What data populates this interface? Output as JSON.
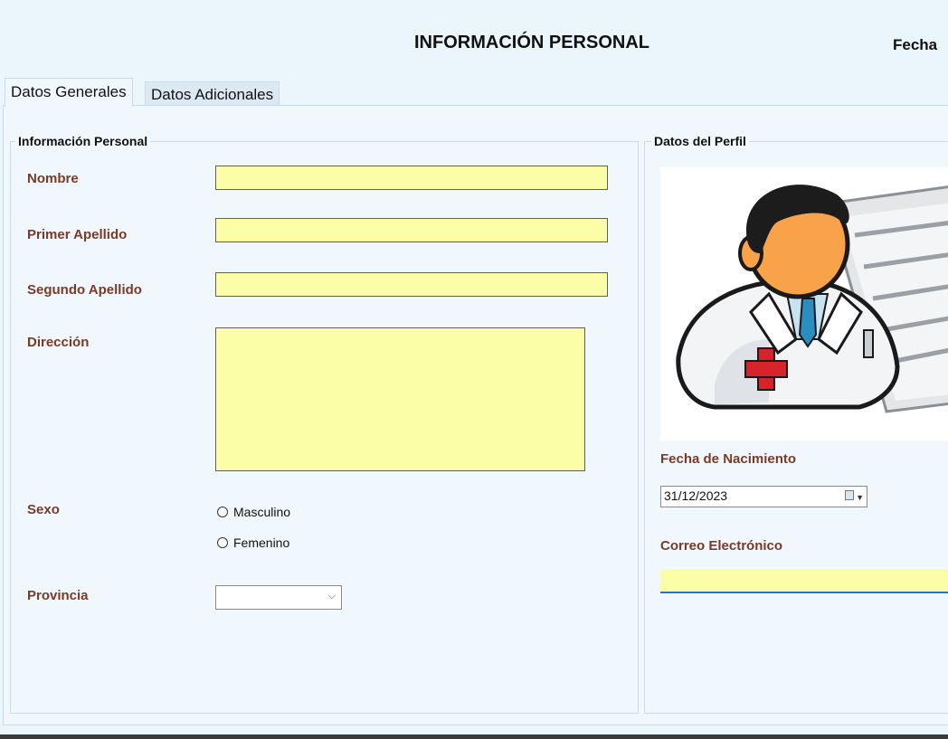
{
  "header": {
    "title": "INFORMACIÓN PERSONAL",
    "fecha_label": "Fecha"
  },
  "tabs": [
    {
      "label": "Datos Generales",
      "active": true
    },
    {
      "label": "Datos Adicionales",
      "active": false
    }
  ],
  "personal": {
    "group_title": "Información Personal",
    "nombre_label": "Nombre",
    "nombre_value": "",
    "primer_apellido_label": "Primer Apellido",
    "primer_apellido_value": "",
    "segundo_apellido_label": "Segundo Apellido",
    "segundo_apellido_value": "",
    "direccion_label": "Dirección",
    "direccion_value": "",
    "sexo_label": "Sexo",
    "sexo_options": [
      "Masculino",
      "Femenino"
    ],
    "provincia_label": "Provincia",
    "provincia_value": ""
  },
  "perfil": {
    "group_title": "Datos del Perfil",
    "avatar_icon": "doctor-avatar-icon",
    "fecha_nacimiento_label": "Fecha de Nacimiento",
    "fecha_nacimiento_value": "31/12/2023",
    "correo_label": "Correo Electrónico",
    "correo_value": ""
  },
  "colors": {
    "field_bg": "#fbfea6",
    "label_color": "#7a3a26",
    "background": "#eaf6fc",
    "accent": "#2a71c6"
  }
}
